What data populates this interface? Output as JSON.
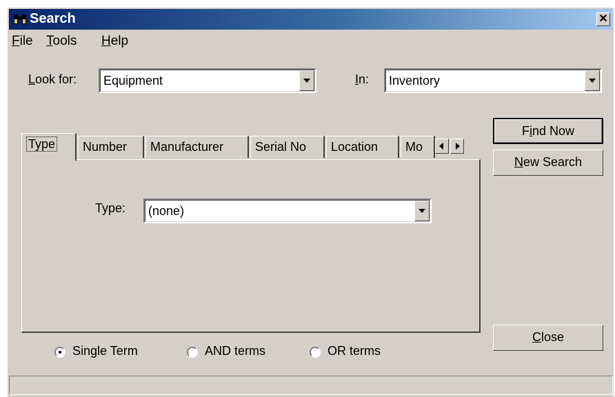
{
  "window": {
    "title": "Search",
    "close_glyph": "✕",
    "icon": "binoculars-icon"
  },
  "menu": [
    {
      "accel": "F",
      "rest": "ile"
    },
    {
      "accel": "T",
      "rest": "ools"
    },
    {
      "accel": "H",
      "rest": "elp"
    }
  ],
  "look_for": {
    "label_accel": "L",
    "label_rest": "ook for:",
    "value": "Equipment"
  },
  "in": {
    "label_accel": "I",
    "label_rest": "n:",
    "value": "Inventory"
  },
  "tabs": [
    "Type",
    "Number",
    "Manufacturer",
    "Serial No",
    "Location",
    "Mo"
  ],
  "type_field": {
    "label": "Type:",
    "value": "(none)"
  },
  "buttons": {
    "find_now": {
      "pre": "F",
      "accel": "i",
      "rest": "nd Now"
    },
    "new_search": {
      "accel": "N",
      "rest": "ew Search"
    },
    "close": {
      "accel": "C",
      "rest": "lose"
    }
  },
  "options": [
    {
      "label": "Single Term",
      "selected": true
    },
    {
      "label": "AND terms",
      "selected": false
    },
    {
      "label": "OR terms",
      "selected": false
    }
  ],
  "status": ""
}
